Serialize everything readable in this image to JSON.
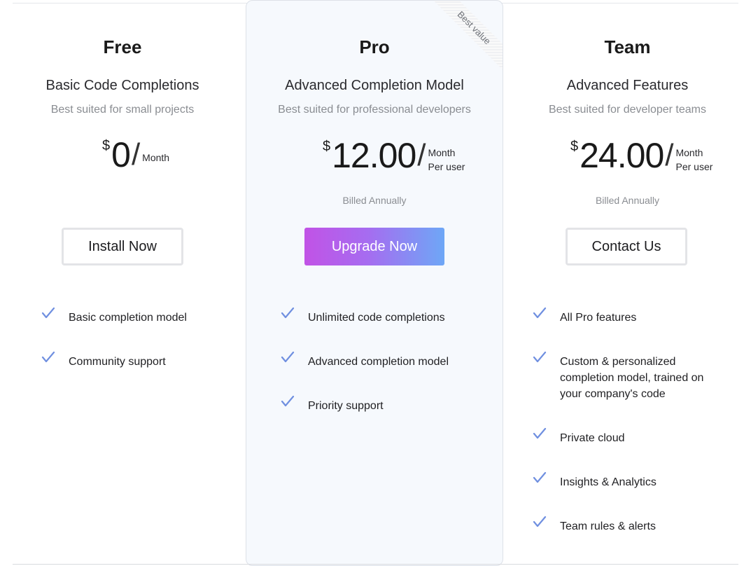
{
  "plans": {
    "free": {
      "name": "Free",
      "headline": "Basic Code Completions",
      "subtitle": "Best suited for small projects",
      "currency": "$",
      "amount": "0",
      "slash": "/",
      "period_line1": "Month",
      "button_label": "Install Now",
      "features": [
        "Basic completion model",
        "Community support"
      ]
    },
    "pro": {
      "ribbon": "Best value",
      "name": "Pro",
      "headline": "Advanced Completion Model",
      "subtitle": "Best suited for professional developers",
      "currency": "$",
      "amount": "12.00",
      "slash": "/",
      "period_line1": "Month",
      "period_line2": "Per user",
      "billing": "Billed Annually",
      "button_label": "Upgrade Now",
      "features": [
        "Unlimited code completions",
        "Advanced completion model",
        "Priority support"
      ]
    },
    "team": {
      "name": "Team",
      "headline": "Advanced Features",
      "subtitle": "Best suited for developer teams",
      "currency": "$",
      "amount": "24.00",
      "slash": "/",
      "period_line1": "Month",
      "period_line2": "Per user",
      "billing": "Billed Annually",
      "button_label": "Contact Us",
      "features": [
        "All Pro features",
        "Custom & personalized completion model, trained on your company's code",
        "Private cloud",
        "Insights & Analytics",
        "Team rules & alerts"
      ]
    }
  },
  "icons": {
    "feature_bullet": "check-icon"
  },
  "colors": {
    "accent_gradient_start": "#c153e6",
    "accent_gradient_end": "#6ea7f6",
    "check": "#6f8fe0",
    "pro_panel_bg": "#f6f9fd"
  }
}
